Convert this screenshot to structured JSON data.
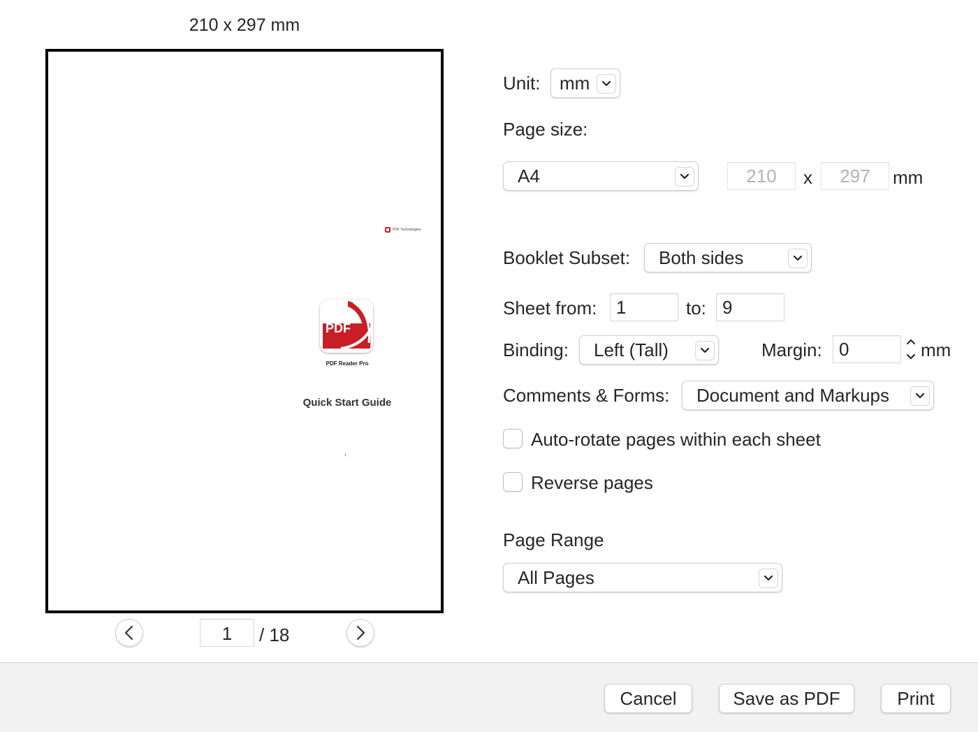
{
  "preview": {
    "size_label": "210 x 297 mm",
    "page_brand": "PDF Technologies",
    "app_icon_text": "PDF",
    "app_name": "PDF Reader Pro",
    "guide_title": "Quick Start Guide",
    "tiny_mark": "1"
  },
  "pager": {
    "current_page": "1",
    "total_label": "/ 18"
  },
  "unit": {
    "label": "Unit:",
    "value": "mm"
  },
  "page_size": {
    "label": "Page size:",
    "value": "A4",
    "width": "210",
    "times": "x",
    "height": "297",
    "unit": "mm"
  },
  "booklet_subset": {
    "label": "Booklet Subset:",
    "value": "Both sides"
  },
  "sheet": {
    "from_label": "Sheet from:",
    "from_value": "1",
    "to_label": "to:",
    "to_value": "9"
  },
  "binding": {
    "label": "Binding:",
    "value": "Left (Tall)"
  },
  "margin": {
    "label": "Margin:",
    "value": "0",
    "unit": "mm"
  },
  "comments_forms": {
    "label": "Comments & Forms:",
    "value": "Document and Markups"
  },
  "options": {
    "auto_rotate": {
      "label": "Auto-rotate pages within each sheet",
      "checked": false
    },
    "reverse": {
      "label": "Reverse pages",
      "checked": false
    }
  },
  "page_range": {
    "label": "Page Range",
    "value": "All Pages"
  },
  "buttons": {
    "cancel": "Cancel",
    "save_pdf": "Save as PDF",
    "print": "Print"
  },
  "colors": {
    "brand_red": "#c81e26",
    "footer_bg": "#f2f2f2"
  }
}
